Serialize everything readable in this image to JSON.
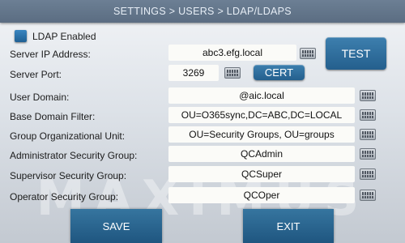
{
  "header": {
    "title": "SETTINGS > USERS > LDAP/LDAPS"
  },
  "ldap": {
    "enabled_label": "LDAP Enabled",
    "enabled": false
  },
  "fields": {
    "server_ip": {
      "label": "Server IP Address:",
      "value": "abc3.efg.local"
    },
    "server_port": {
      "label": "Server Port:",
      "value": "3269"
    },
    "user_domain": {
      "label": "User Domain:",
      "value": "@aic.local"
    },
    "base_domain_filter": {
      "label": "Base Domain Filter:",
      "value": "OU=O365sync,DC=ABC,DC=LOCAL"
    },
    "group_ou": {
      "label": "Group Organizational Unit:",
      "value": "OU=Security Groups, OU=groups"
    },
    "admin_group": {
      "label": "Administrator Security Group:",
      "value": "QCAdmin"
    },
    "supervisor_group": {
      "label": "Supervisor Security Group:",
      "value": "QCSuper"
    },
    "operator_group": {
      "label": "Operator Security Group:",
      "value": "QCOper"
    }
  },
  "buttons": {
    "test": "TEST",
    "cert": "CERT",
    "save": "SAVE",
    "exit": "EXIT"
  },
  "watermark": "MAXIMUS",
  "icons": {
    "keyboard": "keyboard-icon"
  },
  "colors": {
    "accent": "#245f8d",
    "titlebar": "#5b6d82",
    "field_bg": "#fbfbf8"
  }
}
